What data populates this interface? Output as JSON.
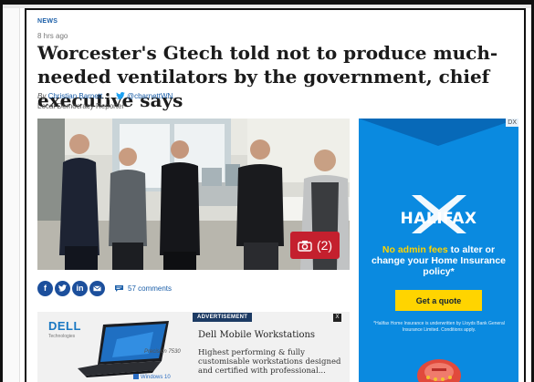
{
  "article": {
    "section": "NEWS",
    "time_ago": "8 hrs ago",
    "headline": "Worcester's Gtech told not to produce much-needed ventilators by the government, chief executive says",
    "byline_prefix": "By",
    "author": "Christian Barnett",
    "twitter_handle": "@cbarnettWN",
    "author_role": "Local Democracy Reporter"
  },
  "photo": {
    "gallery_count": "(2)",
    "gallery_icon": "camera-icon"
  },
  "share": {
    "icons": [
      "facebook-icon",
      "twitter-icon",
      "linkedin-icon",
      "email-icon"
    ],
    "comments_label": "57 comments"
  },
  "side_ad": {
    "ad_choices": "DX",
    "brand": "HALIFAX",
    "copy_highlight": "No admin fees",
    "copy_rest": "to alter or change your Home Insurance policy*",
    "cta": "Get a quote",
    "terms": "*Halifax Home Insurance is underwritten by Lloyds Bank General Insurance Limited. Conditions apply.",
    "colors": {
      "background": "#0a8ae0",
      "highlight": "#ffd400"
    }
  },
  "promo": {
    "tag": "ADVERTISEMENT",
    "close": "X",
    "brand": "DELL",
    "brand_sub": "Technologies",
    "model": "Precision 7530",
    "os_badge": "Windows 10",
    "title": "Dell Mobile Workstations",
    "description": "Highest performing & fully customisable workstations designed and certified with professional..."
  }
}
